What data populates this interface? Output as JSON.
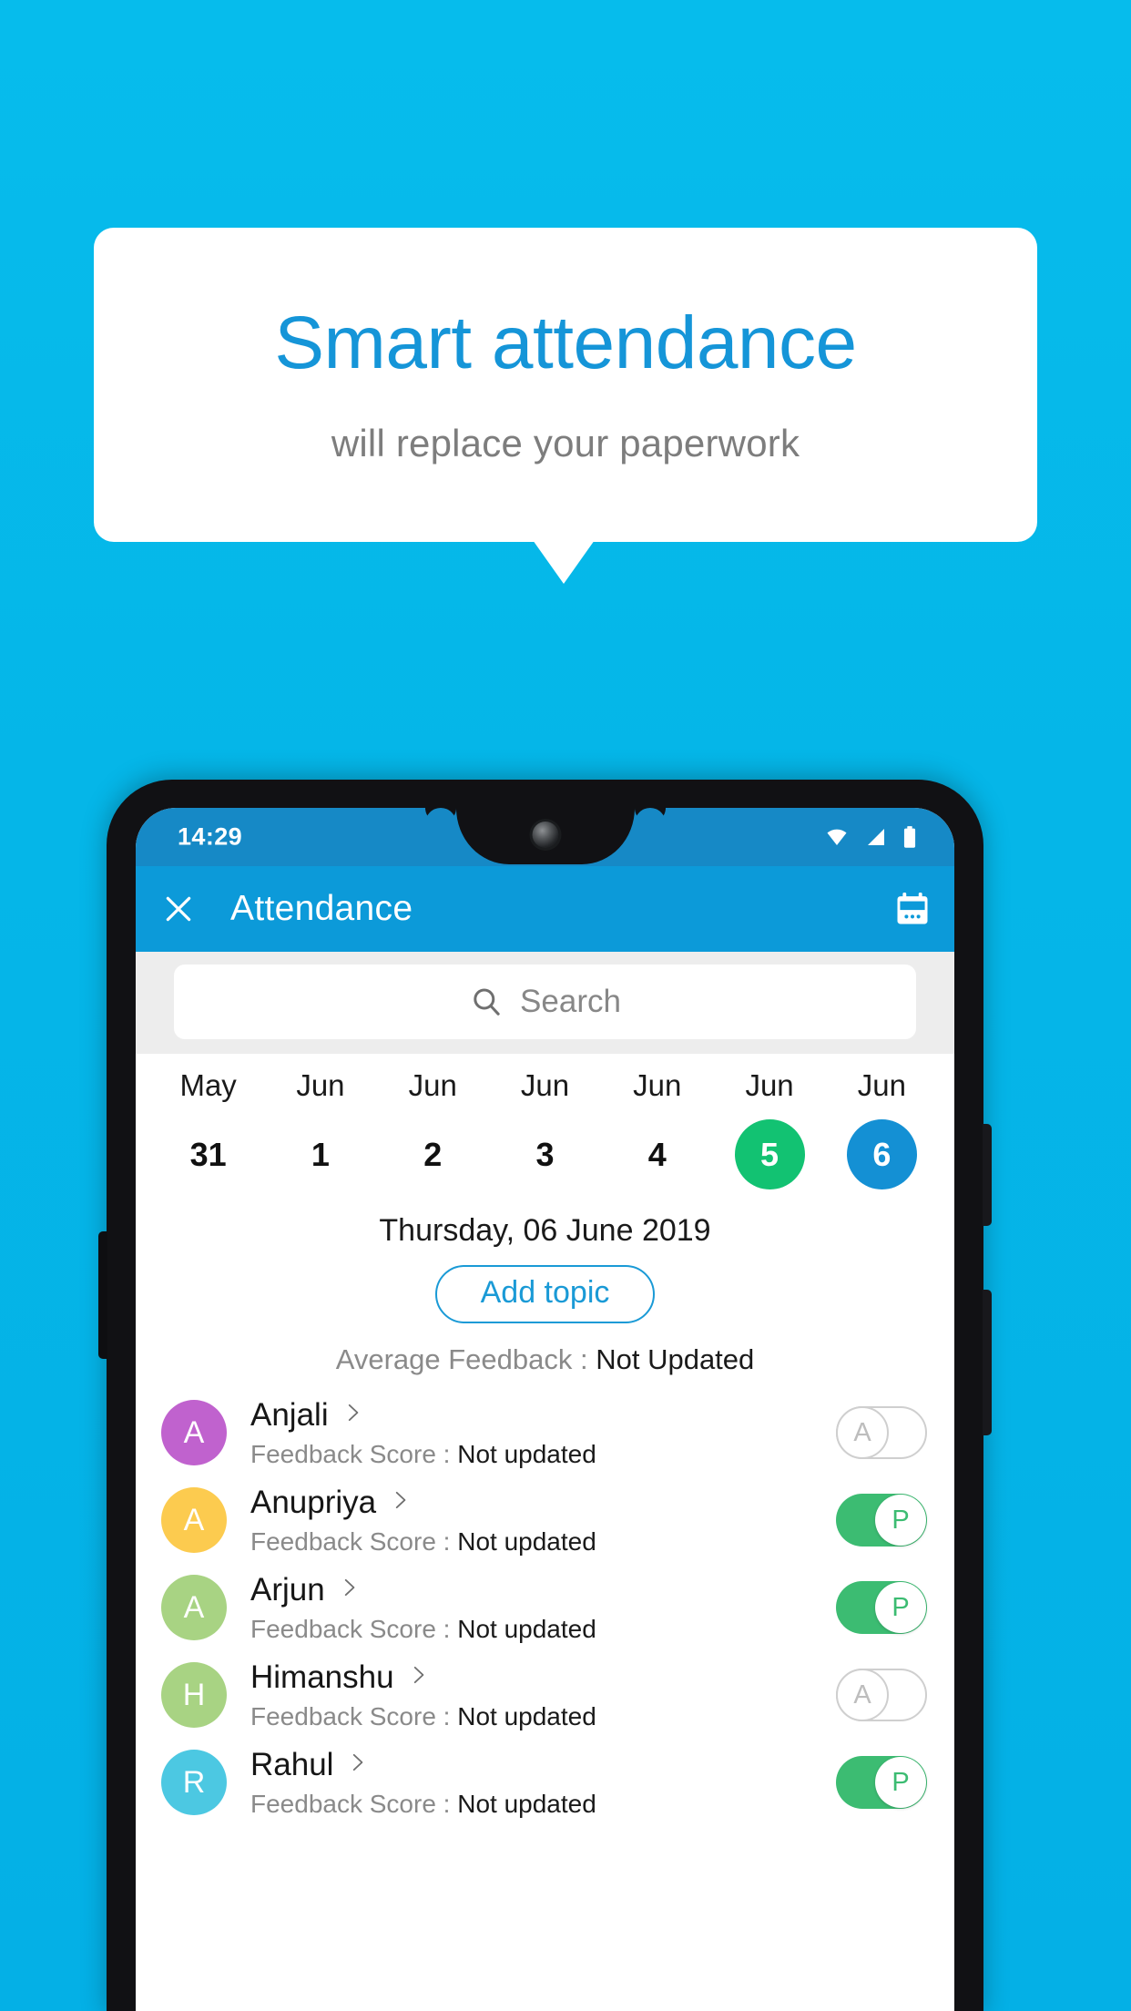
{
  "promo": {
    "title": "Smart attendance",
    "subtitle": "will replace your paperwork",
    "title_color": "#1595D8",
    "subtitle_color": "#7D7D7D",
    "background_color": "#05B6E8"
  },
  "status_bar": {
    "time": "14:29",
    "icons": [
      "wifi-icon",
      "signal-icon",
      "battery-icon"
    ],
    "background_color": "#1689C6"
  },
  "app_bar": {
    "close_label": "close-icon",
    "title": "Attendance",
    "calendar_label": "calendar-icon",
    "background_color": "#0C9AD9"
  },
  "search": {
    "placeholder": "Search"
  },
  "date_strip": [
    {
      "month": "May",
      "day": "31",
      "state": "normal"
    },
    {
      "month": "Jun",
      "day": "1",
      "state": "normal"
    },
    {
      "month": "Jun",
      "day": "2",
      "state": "normal"
    },
    {
      "month": "Jun",
      "day": "3",
      "state": "normal"
    },
    {
      "month": "Jun",
      "day": "4",
      "state": "normal"
    },
    {
      "month": "Jun",
      "day": "5",
      "state": "green"
    },
    {
      "month": "Jun",
      "day": "6",
      "state": "blue"
    }
  ],
  "selected_date_label": "Thursday, 06 June 2019",
  "add_topic_label": "Add topic",
  "average_feedback": {
    "label": "Average Feedback : ",
    "value": "Not Updated"
  },
  "students": [
    {
      "name": "Anjali",
      "initial": "A",
      "avatar_color": "#C062CE",
      "feedback_label": "Feedback Score : ",
      "feedback_value": "Not updated",
      "attendance": "A",
      "attendance_state": "absent"
    },
    {
      "name": "Anupriya",
      "initial": "A",
      "avatar_color": "#FCCB4F",
      "feedback_label": "Feedback Score : ",
      "feedback_value": "Not updated",
      "attendance": "P",
      "attendance_state": "present"
    },
    {
      "name": "Arjun",
      "initial": "A",
      "avatar_color": "#A8D383",
      "feedback_label": "Feedback Score : ",
      "feedback_value": "Not updated",
      "attendance": "P",
      "attendance_state": "present"
    },
    {
      "name": "Himanshu",
      "initial": "H",
      "avatar_color": "#A8D383",
      "feedback_label": "Feedback Score : ",
      "feedback_value": "Not updated",
      "attendance": "A",
      "attendance_state": "absent"
    },
    {
      "name": "Rahul",
      "initial": "R",
      "avatar_color": "#4CC8E2",
      "feedback_label": "Feedback Score : ",
      "feedback_value": "Not updated",
      "attendance": "P",
      "attendance_state": "present"
    }
  ]
}
